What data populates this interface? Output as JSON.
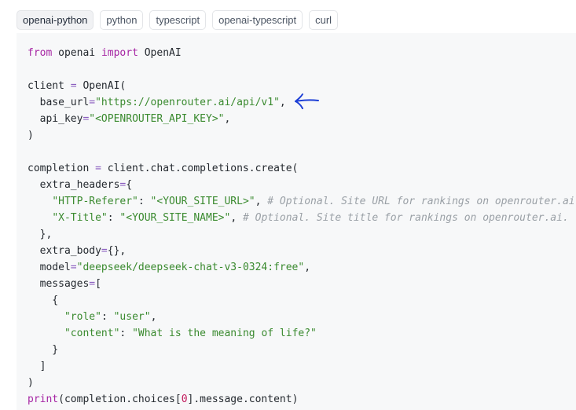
{
  "tabs": [
    {
      "label": "openai-python",
      "active": true
    },
    {
      "label": "python",
      "active": false
    },
    {
      "label": "typescript",
      "active": false
    },
    {
      "label": "openai-typescript",
      "active": false
    },
    {
      "label": "curl",
      "active": false
    }
  ],
  "code": {
    "import_from": "from",
    "import_module": " openai ",
    "import_kw": "import",
    "import_name": " OpenAI",
    "client_var": "client ",
    "client_eq": "=",
    "client_ctor": " OpenAI(",
    "base_url_key": "  base_url",
    "base_url_eq": "=",
    "base_url_val": "\"https://openrouter.ai/api/v1\"",
    "base_url_comma": ",",
    "api_key_key": "  api_key",
    "api_key_eq": "=",
    "api_key_val": "\"<OPENROUTER_API_KEY>\"",
    "api_key_comma": ",",
    "close_paren_1": ")",
    "completion_var": "completion ",
    "completion_eq": "=",
    "completion_call": " client.chat.completions.create(",
    "extra_headers_key": "  extra_headers",
    "extra_headers_eq": "=",
    "extra_headers_open": "{",
    "referer_key": "\"HTTP-Referer\"",
    "referer_colon": ": ",
    "referer_val": "\"<YOUR_SITE_URL>\"",
    "referer_comma": ", ",
    "referer_comment": "# Optional. Site URL for rankings on openrouter.ai.",
    "title_key": "\"X-Title\"",
    "title_colon": ": ",
    "title_val": "\"<YOUR_SITE_NAME>\"",
    "title_comma": ", ",
    "title_comment": "# Optional. Site title for rankings on openrouter.ai.",
    "extra_headers_close": "  },",
    "extra_body_key": "  extra_body",
    "extra_body_eq": "=",
    "extra_body_val": "{},",
    "model_key": "  model",
    "model_eq": "=",
    "model_val": "\"deepseek/deepseek-chat-v3-0324:free\"",
    "model_comma": ",",
    "messages_key": "  messages",
    "messages_eq": "=",
    "messages_open": "[",
    "msg_open": "    {",
    "role_key": "\"role\"",
    "role_colon": ": ",
    "role_val": "\"user\"",
    "role_comma": ",",
    "content_key": "\"content\"",
    "content_colon": ": ",
    "content_val": "\"What is the meaning of life?\"",
    "msg_close": "    }",
    "messages_close": "  ]",
    "close_paren_2": ")",
    "print_fn": "print",
    "print_args_a": "(completion.choices[",
    "print_index": "0",
    "print_args_b": "].message.content)"
  },
  "annotation": {
    "arrow_color": "#1d3fd6"
  }
}
